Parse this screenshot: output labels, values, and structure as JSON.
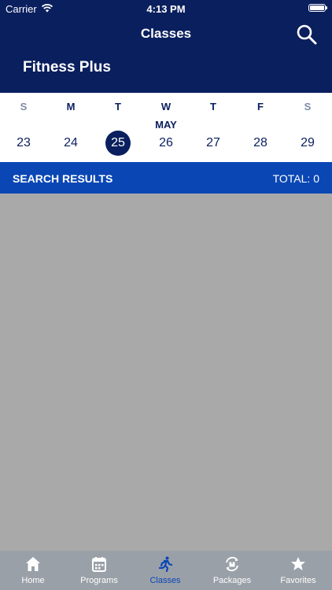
{
  "status": {
    "carrier": "Carrier",
    "time": "4:13 PM"
  },
  "header": {
    "title": "Classes",
    "gym_name": "Fitness Plus"
  },
  "calendar": {
    "month": "MAY",
    "weekdays": [
      "S",
      "M",
      "T",
      "W",
      "T",
      "F",
      "S"
    ],
    "dates": [
      "23",
      "24",
      "25",
      "26",
      "27",
      "28",
      "29"
    ],
    "selected_index": 2
  },
  "results": {
    "title": "SEARCH RESULTS",
    "total": "TOTAL: 0"
  },
  "tabs": [
    {
      "label": "Home",
      "icon": "home-icon"
    },
    {
      "label": "Programs",
      "icon": "calendar-icon"
    },
    {
      "label": "Classes",
      "icon": "running-icon"
    },
    {
      "label": "Packages",
      "icon": "package-icon"
    },
    {
      "label": "Favorites",
      "icon": "star-icon"
    }
  ],
  "colors": {
    "header": "#0a1f5e",
    "accent": "#0a47b5",
    "list_bg": "#a9a9a9",
    "tabbar": "#9aa0a8"
  }
}
